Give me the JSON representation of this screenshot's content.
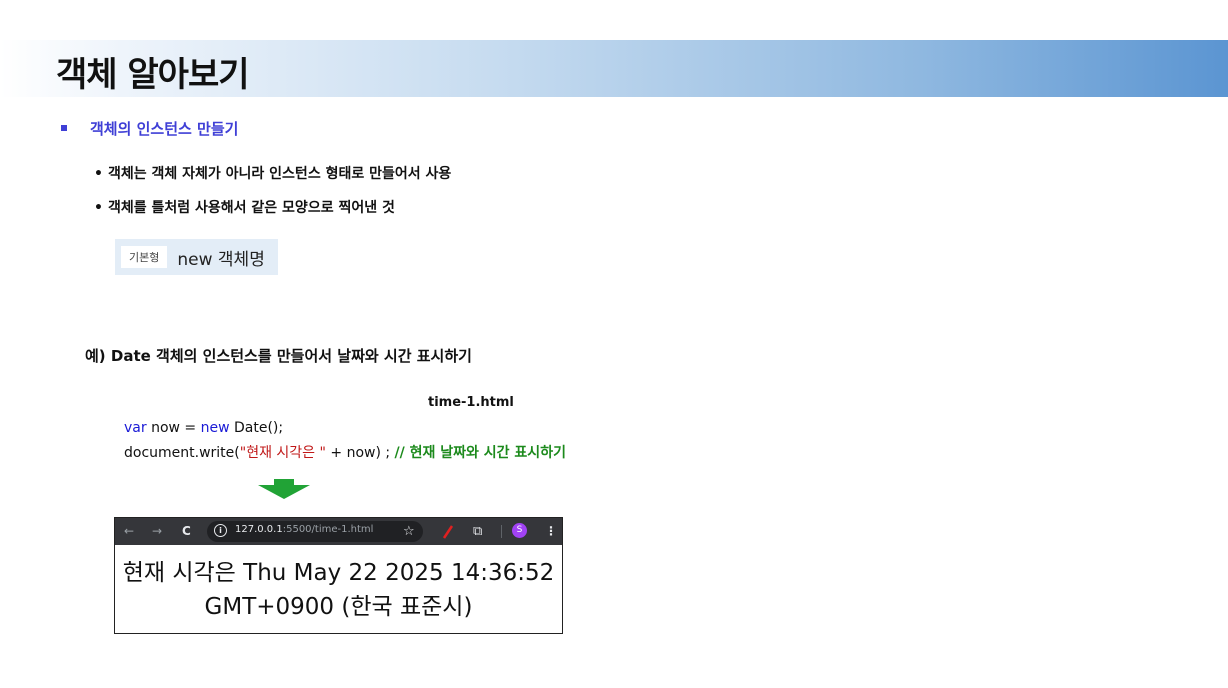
{
  "slide": {
    "title": "객체 알아보기"
  },
  "section": {
    "heading": "객체의 인스턴스 만들기",
    "items": [
      "객체는 객체 자체가 아니라 인스턴스 형태로 만들어서 사용",
      "객체를  틀처럼 사용해서 같은 모양으로 찍어낸 것"
    ],
    "bullet_char": "•"
  },
  "syntax": {
    "tag": "기본형",
    "text": "new 객체명"
  },
  "example": {
    "heading": "예) Date 객체의 인스턴스를 만들어서 날짜와 시간 표시하기",
    "file_label": "time-1.html",
    "code": {
      "line1_kw_var": "var",
      "line1_mid": " now = ",
      "line1_kw_new": "new",
      "line1_end": " Date();",
      "line2_start": "document.write(",
      "line2_string": "\"현재 시각은 \"",
      "line2_end": " + now) ; ",
      "line2_comment": "// 현재 날짜와 시간 표시하기"
    }
  },
  "browser": {
    "nav_back": "←",
    "nav_forward": "→",
    "reload": "C",
    "info_icon": "i",
    "url_host": "127.0.0.1",
    "url_rest": ":5500/time-1.html",
    "star": "☆",
    "extensions": "⧉",
    "profile_letter": "S",
    "menu": "⋮",
    "output_line1": "현재 시각은 Thu May 22 2025 14:36:52",
    "output_line2": "GMT+0900 (한국 표준시)"
  },
  "colors": {
    "heading_blue": "#3f3fd6",
    "keyword_blue": "#1a1ad6",
    "string_red": "#c01818",
    "comment_green": "#1c8a1c",
    "arrow_green": "#21a336",
    "browser_toolbar": "#35363a",
    "profile_purple": "#a142f4"
  }
}
